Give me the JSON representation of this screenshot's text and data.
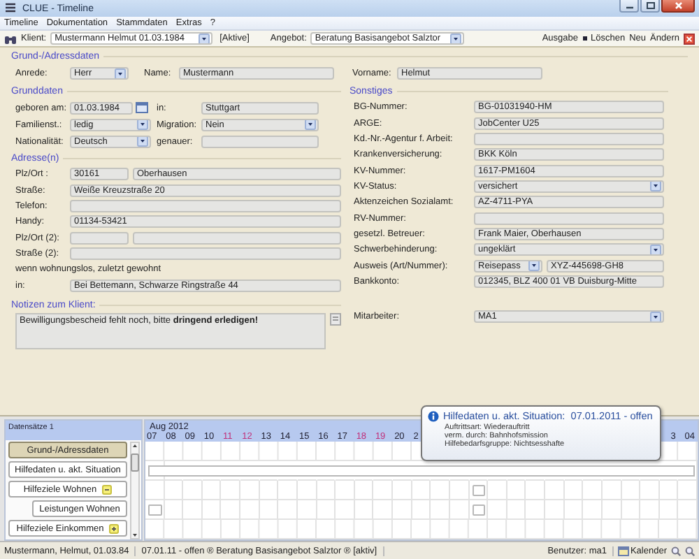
{
  "window": {
    "title": "CLUE - Timeline"
  },
  "menu": [
    "Timeline",
    "Dokumentation",
    "Stammdaten",
    "Extras",
    "?"
  ],
  "toolbar": {
    "client_label": "Klient:",
    "client": "Mustermann Helmut 01.03.1984",
    "filter": "[Aktive]",
    "offer_label": "Angebot:",
    "offer": "Beratung Basisangebot Salztor",
    "actions": [
      "Ausgabe",
      "Löschen",
      "Neu",
      "Ändern"
    ]
  },
  "form": {
    "title": "Grund-/Adressdaten",
    "top": [
      {
        "label": "Anrede:",
        "kind": "select",
        "value": "Herr"
      },
      {
        "label": "Name:",
        "kind": "text",
        "value": "Mustermann"
      },
      {
        "label": "Vorname:",
        "kind": "text",
        "value": "Helmut"
      }
    ],
    "basic": {
      "title": "Grunddaten",
      "rows": [
        [
          {
            "label": "geboren am:",
            "kind": "date",
            "value": "01.03.1984"
          },
          {
            "label": "in:",
            "kind": "text",
            "value": "Stuttgart"
          }
        ],
        [
          {
            "label": "Familienst.:",
            "kind": "select",
            "value": "ledig"
          },
          {
            "label": "Migration:",
            "kind": "select",
            "value": "Nein"
          }
        ],
        [
          {
            "label": "Nationalität:",
            "kind": "select",
            "value": "Deutsch"
          },
          {
            "label": "genauer:",
            "kind": "text"
          }
        ]
      ]
    },
    "address": {
      "title": "Adresse(n)",
      "rows": [
        {
          "label": "Plz/Ort :",
          "fields": [
            {
              "kind": "text",
              "value": "30161"
            },
            {
              "kind": "text",
              "value": "Oberhausen"
            }
          ]
        },
        {
          "label": "Straße:",
          "fields": [
            {
              "kind": "text",
              "value": "Weiße Kreuzstraße 20"
            }
          ]
        },
        {
          "label": "Telefon:",
          "fields": [
            {
              "kind": "text"
            }
          ]
        },
        {
          "label": "Handy:",
          "fields": [
            {
              "kind": "text",
              "value": "01134-53421"
            }
          ]
        },
        {
          "label": "Plz/Ort  (2):",
          "fields": [
            {
              "kind": "text"
            },
            {
              "kind": "text"
            }
          ]
        },
        {
          "label": "Straße  (2):",
          "fields": [
            {
              "kind": "text"
            }
          ]
        },
        {
          "label": "wenn wohnungslos, zuletzt gewohnt"
        },
        {
          "label": "in:",
          "fields": [
            {
              "kind": "text",
              "value": "Bei Bettemann, Schwarze Ringstraße 44"
            }
          ]
        }
      ]
    },
    "notes": {
      "label": "Notizen zum Klient:",
      "text": "Bewilligungsbescheid fehlt noch, bitte **dringend erledigen!**"
    },
    "other": {
      "title": "Sonstiges",
      "rows": [
        {
          "label": "BG-Nummer:",
          "fields": [
            {
              "kind": "text",
              "value": "BG-01031940-HM"
            }
          ]
        },
        {
          "label": "ARGE:",
          "fields": [
            {
              "kind": "text",
              "value": "JobCenter U25"
            }
          ]
        },
        {
          "label": "Kd.-Nr.-Agentur f. Arbeit:",
          "fields": [
            {
              "kind": "text"
            }
          ]
        },
        {
          "label": "Krankenversicherung:",
          "fields": [
            {
              "kind": "text",
              "value": "BKK Köln"
            }
          ]
        },
        {
          "label": "KV-Nummer:",
          "fields": [
            {
              "kind": "text",
              "value": "1617-PM1604"
            }
          ]
        },
        {
          "label": "KV-Status:",
          "fields": [
            {
              "kind": "select",
              "value": "versichert"
            }
          ]
        },
        {
          "label": "Aktenzeichen Sozialamt:",
          "fields": [
            {
              "kind": "text",
              "value": "AZ-4711-PYA"
            }
          ]
        },
        {
          "label": "RV-Nummer:",
          "fields": [
            {
              "kind": "text"
            }
          ]
        },
        {
          "label": "gesetzl. Betreuer:",
          "fields": [
            {
              "kind": "text",
              "value": "Frank Maier, Oberhausen"
            }
          ]
        },
        {
          "label": "Schwerbehinderung:",
          "fields": [
            {
              "kind": "select",
              "value": "ungeklärt"
            }
          ]
        },
        {
          "label": "Ausweis (Art/Nummer):",
          "fields": [
            {
              "kind": "select",
              "value": "Reisepass"
            },
            {
              "kind": "text",
              "value": "XYZ-445698-GH8"
            }
          ]
        },
        {
          "label": "Bankkonto:",
          "fields": [
            {
              "kind": "text",
              "value": "012345, BLZ 400 01 VB Duisburg-Mitte"
            }
          ]
        }
      ]
    },
    "staff": {
      "label": "Mitarbeiter:",
      "kind": "select",
      "value": "MA1"
    }
  },
  "timeline": {
    "count_label": "Datensätze 1",
    "month": "Aug 2012",
    "days": [
      {
        "label": "07",
        "weekend": false
      },
      {
        "label": "08",
        "weekend": false
      },
      {
        "label": "09",
        "weekend": false
      },
      {
        "label": "10",
        "weekend": false
      },
      {
        "label": "11",
        "weekend": true
      },
      {
        "label": "12",
        "weekend": true
      },
      {
        "label": "13",
        "weekend": false
      },
      {
        "label": "14",
        "weekend": false
      },
      {
        "label": "15",
        "weekend": false
      },
      {
        "label": "16",
        "weekend": false
      },
      {
        "label": "17",
        "weekend": false
      },
      {
        "label": "18",
        "weekend": true
      },
      {
        "label": "19",
        "weekend": true
      },
      {
        "label": "20",
        "weekend": false
      },
      {
        "label": "2",
        "weekend": false
      }
    ],
    "days_end": [
      {
        "label": "3",
        "weekend": false
      },
      {
        "label": "04",
        "weekend": false
      }
    ],
    "rows": [
      {
        "label": "Grund-/Adressdaten",
        "selected": true
      },
      {
        "label": "Hilfedaten u. akt. Situation",
        "selected": false,
        "marks": [
          true,
          true,
          true,
          true,
          true,
          true,
          true,
          true,
          true,
          true,
          true,
          true,
          true,
          true,
          true,
          true,
          true,
          true,
          true,
          true,
          true,
          true,
          true,
          true,
          true,
          true,
          true,
          true,
          true
        ]
      },
      {
        "label": "Hilfeziele Wohnen",
        "selected": false,
        "expanded": true,
        "marks": [
          false,
          false,
          false,
          false,
          false,
          false,
          false,
          false,
          false,
          false,
          false,
          false,
          false,
          false,
          false,
          false,
          false,
          true,
          false,
          false,
          false,
          false,
          false,
          false,
          false,
          false,
          false,
          false,
          false
        ],
        "children": [
          {
            "label": "Leistungen Wohnen",
            "selected": false,
            "marks": [
              true,
              false,
              false,
              false,
              false,
              false,
              false,
              false,
              false,
              false,
              false,
              false,
              false,
              false,
              false,
              false,
              false,
              true,
              false,
              false,
              false,
              false,
              false,
              false,
              false,
              false,
              false,
              false,
              false
            ]
          }
        ]
      },
      {
        "label": "Hilfeziele Einkommen",
        "selected": false,
        "expanded": false
      }
    ]
  },
  "tooltip": {
    "title": "Hilfedaten u. akt. Situation:  07.01.2011 - offen",
    "lines": [
      "Auftrittsart: Wiederauftritt",
      "verm. durch: Bahnhofsmission",
      "Hilfebedarfsgruppe: Nichtsesshafte"
    ]
  },
  "status_bar": {
    "items": [
      "Mustermann, Helmut, 01.03.84",
      "07.01.11 - offen ® Beratung Basisangebot Salztor ® [aktiv]"
    ],
    "user": "Benutzer: ma1",
    "calendar": "Kalender"
  }
}
